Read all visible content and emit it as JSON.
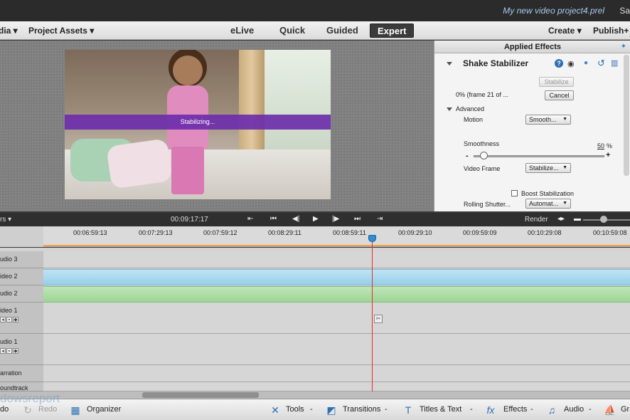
{
  "titlebar": {
    "project": "My new video project4.prel",
    "user": "Sa"
  },
  "menubar": {
    "media": "dia ▾",
    "project_assets": "Project Assets ▾",
    "modes": [
      {
        "label": "eLive",
        "active": false
      },
      {
        "label": "Quick",
        "active": false
      },
      {
        "label": "Guided",
        "active": false
      },
      {
        "label": "Expert",
        "active": true
      }
    ],
    "create": "Create ▾",
    "publish": "Publish+"
  },
  "monitor": {
    "progress_label": "Stabilizing..."
  },
  "effects_panel": {
    "title": "Applied Effects",
    "effect_name": "Shake Stabilizer",
    "stabilize_button": "Stabilize",
    "progress_text": "0% (frame 21 of ...",
    "cancel_button": "Cancel",
    "advanced_label": "Advanced",
    "motion_label": "Motion",
    "motion_value": "Smooth...",
    "smoothness_label": "Smoothness",
    "smoothness_value": "50",
    "smoothness_unit": "%",
    "smoothness_level": 0.05,
    "minus": "-",
    "plus": "+",
    "video_frame_label": "Video Frame",
    "video_frame_value": "Stabilize...",
    "boost_label": "Boost Stabilization",
    "boost_checked": false,
    "rolling_label": "Rolling Shutter...",
    "rolling_value": "Automat..."
  },
  "timeline_toolbar": {
    "left_label": "rs ▾",
    "timecode": "00:09:17:17",
    "render_label": "Render"
  },
  "ruler": {
    "ticks": [
      "00:06:59:13",
      "00:07:29:13",
      "00:07:59:12",
      "00:08:29:11",
      "00:08:59:11",
      "00:09:29:10",
      "00:09:59:09",
      "00:10:29:08",
      "00:10:59:08"
    ]
  },
  "tracks": [
    {
      "label": "udio 3",
      "clip": "none"
    },
    {
      "label": "ideo 2",
      "clip": "blue"
    },
    {
      "label": "udio 2",
      "clip": "green"
    },
    {
      "label": "ideo 1",
      "clip": "none"
    },
    {
      "label": "udio 1",
      "clip": "none"
    },
    {
      "label": "arration",
      "clip": "none"
    },
    {
      "label": "oundtrack",
      "clip": "none"
    }
  ],
  "actionbar": {
    "undo": "do",
    "redo": "Redo",
    "organizer": "Organizer",
    "tools": "Tools",
    "transitions": "Transitions",
    "titles": "Titles & Text",
    "effects": "Effects",
    "audio": "Audio",
    "graphics": "Gr",
    "dash": "-"
  },
  "watermark": "dowsreport",
  "colors": {
    "accent": "#6c2eaa",
    "playhead": "#e23030",
    "clip_blue": "#98cfe9",
    "clip_green": "#9dd596"
  }
}
